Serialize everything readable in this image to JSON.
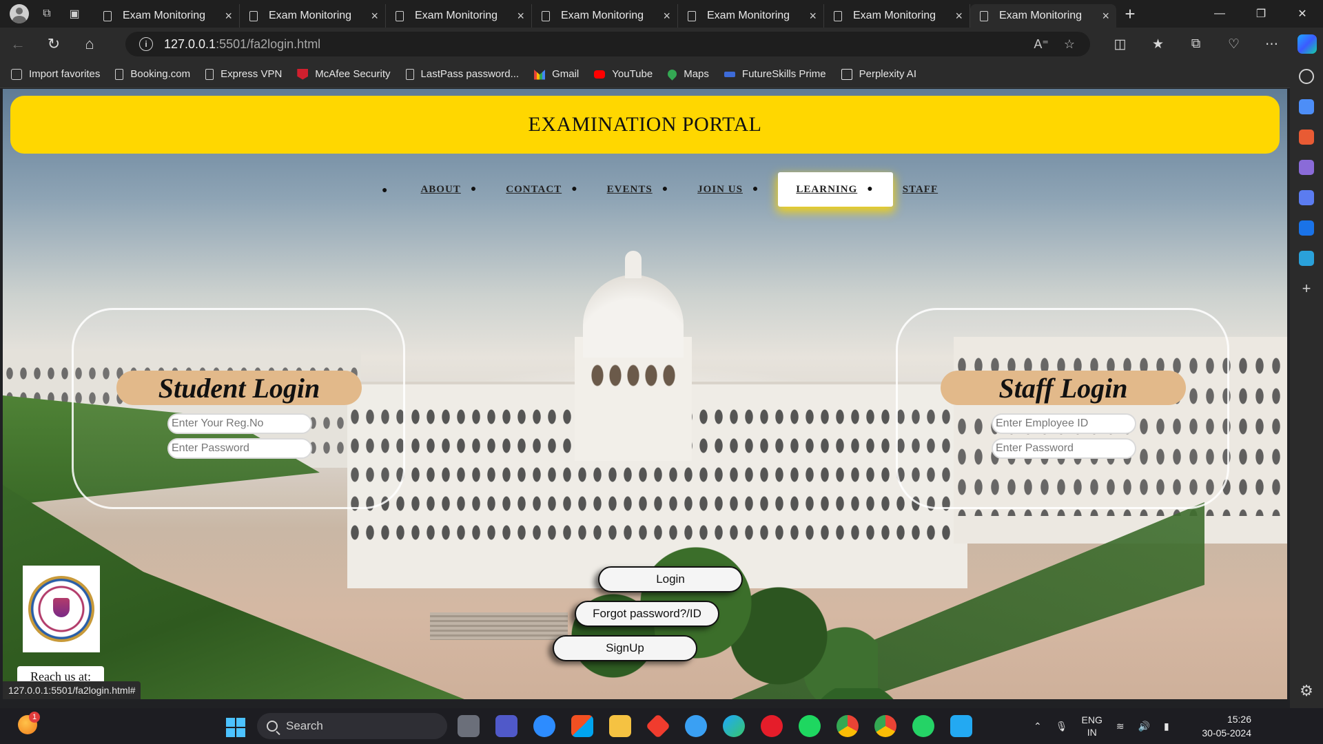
{
  "browser": {
    "tabs": [
      {
        "title": "Exam Monitoring",
        "active": false
      },
      {
        "title": "Exam Monitoring",
        "active": false
      },
      {
        "title": "Exam Monitoring",
        "active": false
      },
      {
        "title": "Exam Monitoring",
        "active": false
      },
      {
        "title": "Exam Monitoring",
        "active": false
      },
      {
        "title": "Exam Monitoring",
        "active": false
      },
      {
        "title": "Exam Monitoring",
        "active": true
      }
    ],
    "url_host": "127.0.0.1",
    "url_path": ":5501/fa2login.html",
    "favorites": [
      {
        "label": "Import favorites",
        "icon": "import-icon"
      },
      {
        "label": "Booking.com",
        "icon": "page-icon"
      },
      {
        "label": "Express VPN",
        "icon": "page-icon"
      },
      {
        "label": "McAfee Security",
        "icon": "mcafee-icon"
      },
      {
        "label": "LastPass password...",
        "icon": "page-icon"
      },
      {
        "label": "Gmail",
        "icon": "gmail-icon"
      },
      {
        "label": "YouTube",
        "icon": "youtube-icon"
      },
      {
        "label": "Maps",
        "icon": "maps-icon"
      },
      {
        "label": "FutureSkills Prime",
        "icon": "futureskills-icon"
      },
      {
        "label": "Perplexity AI",
        "icon": "perplexity-icon"
      }
    ],
    "status_url": "127.0.0.1:5501/fa2login.html#"
  },
  "page": {
    "header_title": "EXAMINATION PORTAL",
    "nav": [
      {
        "label": "ABOUT",
        "active": false
      },
      {
        "label": "CONTACT",
        "active": false
      },
      {
        "label": "EVENTS",
        "active": false
      },
      {
        "label": "JOIN US",
        "active": false
      },
      {
        "label": "LEARNING",
        "active": true
      },
      {
        "label": "STAFF",
        "active": false
      }
    ],
    "student_login": {
      "title": "Student Login",
      "reg_placeholder": "Enter Your Reg.No",
      "password_placeholder": "Enter Password"
    },
    "staff_login": {
      "title": "Staff Login",
      "id_placeholder": "Enter Employee ID",
      "password_placeholder": "Enter Password"
    },
    "buttons": {
      "login": "Login",
      "forgot": "Forgot password?/ID",
      "signup": "SignUp"
    },
    "reach_us": "Reach us at:"
  },
  "taskbar": {
    "search_label": "Search",
    "weather_badge": "1",
    "lang_top": "ENG",
    "lang_bottom": "IN",
    "time": "15:26",
    "date": "30-05-2024"
  },
  "colors": {
    "header_bg": "#ffd700",
    "login_title_bg": "#e2b98a",
    "active_nav_glow": "#ffd700"
  }
}
